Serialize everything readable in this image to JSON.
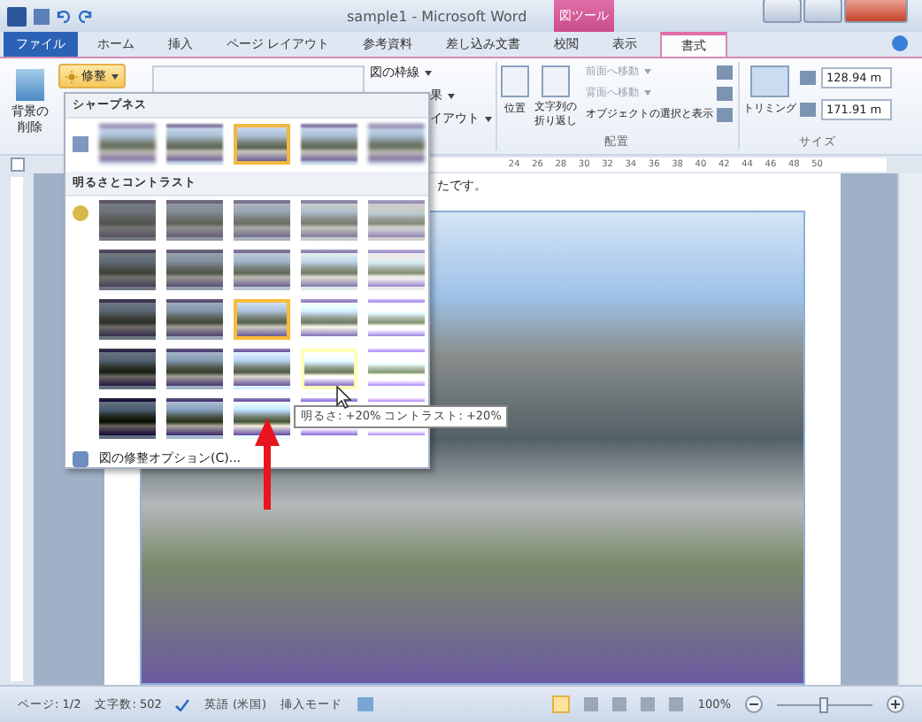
{
  "window": {
    "title": "sample1 - Microsoft Word",
    "context_tab": "図ツール"
  },
  "tabs": [
    {
      "label": "ファイル",
      "kind": "file",
      "selected": false
    },
    {
      "label": "ホーム",
      "kind": "tab",
      "selected": false
    },
    {
      "label": "挿入",
      "kind": "tab",
      "selected": false
    },
    {
      "label": "ページ レイアウト",
      "kind": "tab",
      "selected": false
    },
    {
      "label": "参考資料",
      "kind": "tab",
      "selected": false
    },
    {
      "label": "差し込み文書",
      "kind": "tab",
      "selected": false
    },
    {
      "label": "校閲",
      "kind": "tab",
      "selected": false
    },
    {
      "label": "表示",
      "kind": "tab",
      "selected": false
    },
    {
      "label": "書式",
      "kind": "tab",
      "selected": true
    }
  ],
  "ribbon": {
    "remove_background": "背景の削除",
    "corrections": "修整",
    "border": "図の枠線",
    "effects": "果",
    "layout": "イアウト",
    "position": "位置",
    "wrap_text": "文字列の折り返し",
    "bring_forward": "前面へ移動",
    "send_backward": "背面へ移動",
    "selection_pane": "オブジェクトの選択と表示",
    "arrange_label": "配置",
    "crop": "トリミング",
    "height": "128.94 m",
    "width": "171.91 m",
    "size_label": "サイズ"
  },
  "ruler": [
    "24",
    "26",
    "28",
    "30",
    "32",
    "34",
    "36",
    "38",
    "40",
    "42",
    "44",
    "46",
    "48",
    "50"
  ],
  "gallery": {
    "sharpness_title": "シャープネス",
    "sharpness": [
      {
        "selected": false
      },
      {
        "selected": false
      },
      {
        "selected": true
      },
      {
        "selected": false
      },
      {
        "selected": false
      }
    ],
    "brightness_title": "明るさとコントラスト",
    "brightness": [
      [
        {
          "selected": false,
          "hovered": false
        },
        {
          "selected": false,
          "hovered": false
        },
        {
          "selected": false,
          "hovered": false
        },
        {
          "selected": false,
          "hovered": false
        },
        {
          "selected": false,
          "hovered": false
        }
      ],
      [
        {
          "selected": false,
          "hovered": false
        },
        {
          "selected": false,
          "hovered": false
        },
        {
          "selected": false,
          "hovered": false
        },
        {
          "selected": false,
          "hovered": false
        },
        {
          "selected": false,
          "hovered": false
        }
      ],
      [
        {
          "selected": false,
          "hovered": false
        },
        {
          "selected": false,
          "hovered": false
        },
        {
          "selected": true,
          "hovered": false
        },
        {
          "selected": false,
          "hovered": false
        },
        {
          "selected": false,
          "hovered": false
        }
      ],
      [
        {
          "selected": false,
          "hovered": false
        },
        {
          "selected": false,
          "hovered": false
        },
        {
          "selected": false,
          "hovered": false
        },
        {
          "selected": false,
          "hovered": true
        },
        {
          "selected": false,
          "hovered": false
        }
      ],
      [
        {
          "selected": false,
          "hovered": false
        },
        {
          "selected": false,
          "hovered": false
        },
        {
          "selected": false,
          "hovered": false
        },
        {
          "selected": false,
          "hovered": false
        },
        {
          "selected": false,
          "hovered": false
        }
      ]
    ],
    "options": "図の修整オプション(C)...",
    "tooltip": "明るさ: +20% コントラスト: +20%"
  },
  "document": {
    "text": "たです。"
  },
  "status_bar": {
    "page": "ページ: 1/2",
    "words": "文字数: 502",
    "language": "英語 (米国)",
    "mode": "挿入モード",
    "zoom": "100%",
    "zoom_slider": {
      "level": 0.5
    }
  }
}
